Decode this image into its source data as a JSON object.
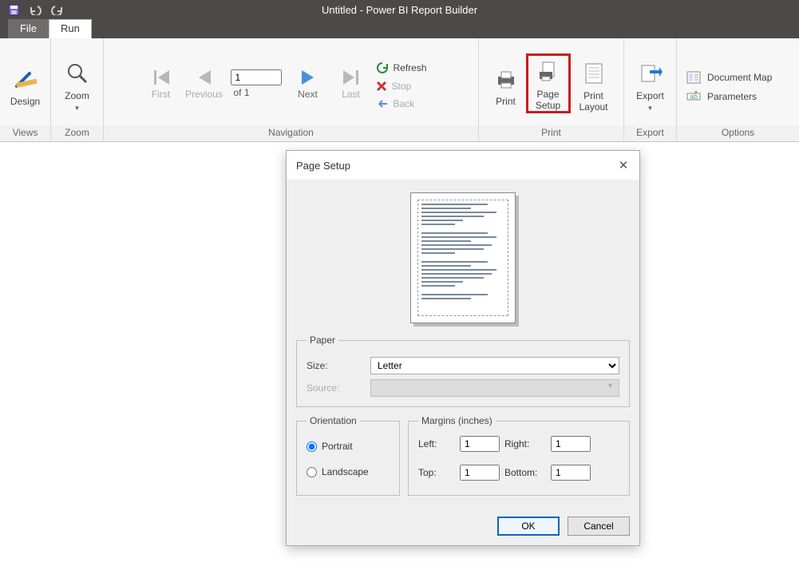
{
  "titlebar": {
    "title": "Untitled - Power BI Report Builder"
  },
  "qat": {
    "save": "save-icon",
    "undo": "undo-icon",
    "redo": "redo-icon"
  },
  "tabs": {
    "file": "File",
    "run": "Run"
  },
  "ribbon": {
    "views": {
      "group_label": "Views",
      "design": "Design"
    },
    "zoom": {
      "group_label": "Zoom",
      "zoom": "Zoom"
    },
    "navigation": {
      "group_label": "Navigation",
      "first": "First",
      "previous": "Previous",
      "page_value": "1",
      "page_of": "of  1",
      "next": "Next",
      "last": "Last",
      "refresh": "Refresh",
      "stop": "Stop",
      "back": "Back"
    },
    "print": {
      "group_label": "Print",
      "print": "Print",
      "page_setup_line1": "Page",
      "page_setup_line2": "Setup",
      "print_layout_line1": "Print",
      "print_layout_line2": "Layout"
    },
    "export": {
      "group_label": "Export",
      "export": "Export"
    },
    "options": {
      "group_label": "Options",
      "document_map": "Document Map",
      "parameters": "Parameters"
    }
  },
  "dialog": {
    "title": "Page Setup",
    "paper": {
      "legend": "Paper",
      "size_label": "Size:",
      "size_value": "Letter",
      "source_label": "Source:"
    },
    "orientation": {
      "legend": "Orientation",
      "portrait": "Portrait",
      "landscape": "Landscape",
      "selected": "portrait"
    },
    "margins": {
      "legend": "Margins (inches)",
      "left_label": "Left:",
      "left_value": "1",
      "right_label": "Right:",
      "right_value": "1",
      "top_label": "Top:",
      "top_value": "1",
      "bottom_label": "Bottom:",
      "bottom_value": "1"
    },
    "buttons": {
      "ok": "OK",
      "cancel": "Cancel"
    }
  }
}
